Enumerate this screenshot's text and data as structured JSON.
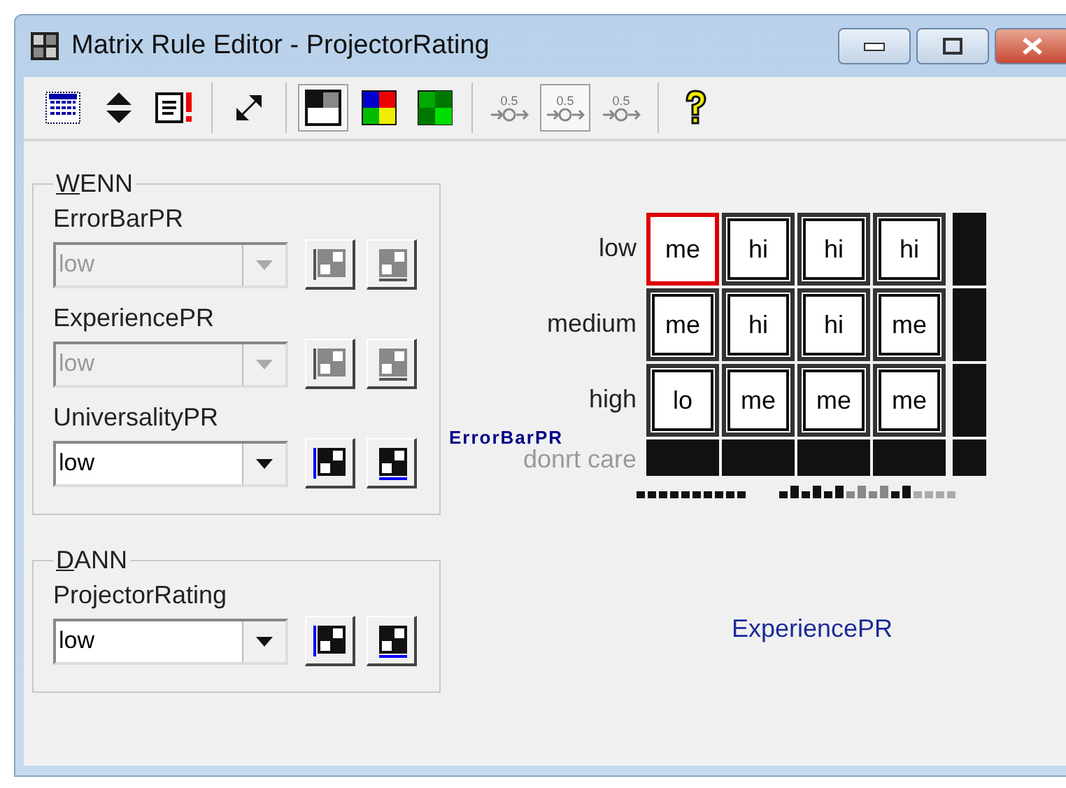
{
  "window": {
    "title": "Matrix Rule Editor - ProjectorRating"
  },
  "toolbar": [
    {
      "kind": "table",
      "selected": false
    },
    {
      "kind": "updown",
      "selected": false
    },
    {
      "kind": "alert",
      "selected": false
    },
    {
      "kind": "sep"
    },
    {
      "kind": "expand",
      "selected": false
    },
    {
      "kind": "sep"
    },
    {
      "kind": "mono",
      "selected": true
    },
    {
      "kind": "color",
      "selected": false
    },
    {
      "kind": "green",
      "selected": false
    },
    {
      "kind": "sep"
    },
    {
      "kind": "weight",
      "label": "0.5",
      "selected": false
    },
    {
      "kind": "weight",
      "label": "0.5",
      "selected": true
    },
    {
      "kind": "weight",
      "label": "0.5",
      "selected": false
    },
    {
      "kind": "sep"
    },
    {
      "kind": "help",
      "selected": false
    }
  ],
  "groups": [
    {
      "title": "WENN",
      "variables": [
        {
          "name": "ErrorBarPR",
          "value": "low",
          "disabled": true
        },
        {
          "name": "ExperiencePR",
          "value": "low",
          "disabled": true
        },
        {
          "name": "UniversalityPR",
          "value": "low",
          "disabled": false
        }
      ]
    },
    {
      "title": "DANN",
      "variables": [
        {
          "name": "ProjectorRating",
          "value": "low",
          "disabled": false
        }
      ]
    }
  ],
  "matrix": {
    "row_axis_label": "ErrorBarPR",
    "column_axis_label": "ExperiencePR",
    "dont_care_label": "donrt care",
    "rows": [
      {
        "label": "low",
        "cells": [
          {
            "value": "me",
            "selected": true
          },
          {
            "value": "hi",
            "selected": false
          },
          {
            "value": "hi",
            "selected": false
          },
          {
            "value": "hi",
            "selected": false
          }
        ]
      },
      {
        "label": "medium",
        "cells": [
          {
            "value": "me",
            "selected": false
          },
          {
            "value": "hi",
            "selected": false
          },
          {
            "value": "hi",
            "selected": false
          },
          {
            "value": "me",
            "selected": false
          }
        ]
      },
      {
        "label": "high",
        "cells": [
          {
            "value": "lo",
            "selected": false
          },
          {
            "value": "me",
            "selected": false
          },
          {
            "value": "me",
            "selected": false
          },
          {
            "value": "me",
            "selected": false
          }
        ]
      }
    ]
  }
}
